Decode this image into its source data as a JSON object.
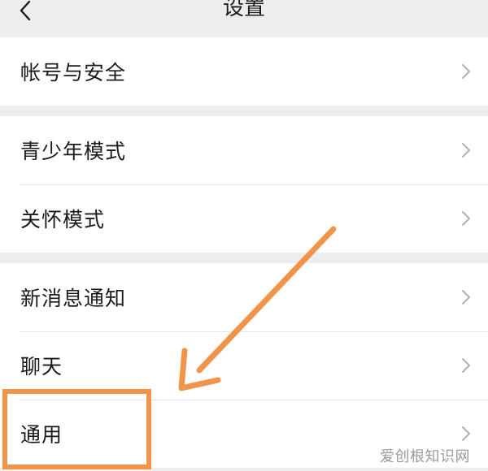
{
  "header": {
    "title": "设置",
    "back_icon": "chevron-left-icon"
  },
  "groups": [
    {
      "items": [
        {
          "label": "帐号与安全"
        }
      ]
    },
    {
      "items": [
        {
          "label": "青少年模式"
        },
        {
          "label": "关怀模式"
        }
      ]
    },
    {
      "items": [
        {
          "label": "新消息通知"
        },
        {
          "label": "聊天"
        },
        {
          "label": "通用"
        }
      ]
    }
  ],
  "row_icon": "chevron-right-icon",
  "annotation": {
    "color": "#f0944b",
    "highlighted_item": "通用"
  },
  "watermark": "爱创根知识网",
  "colors": {
    "background": "#ededed",
    "row_background": "#ffffff",
    "text": "#1a1a1a",
    "chevron": "#b2b2b2",
    "divider": "#e6e6e6"
  }
}
